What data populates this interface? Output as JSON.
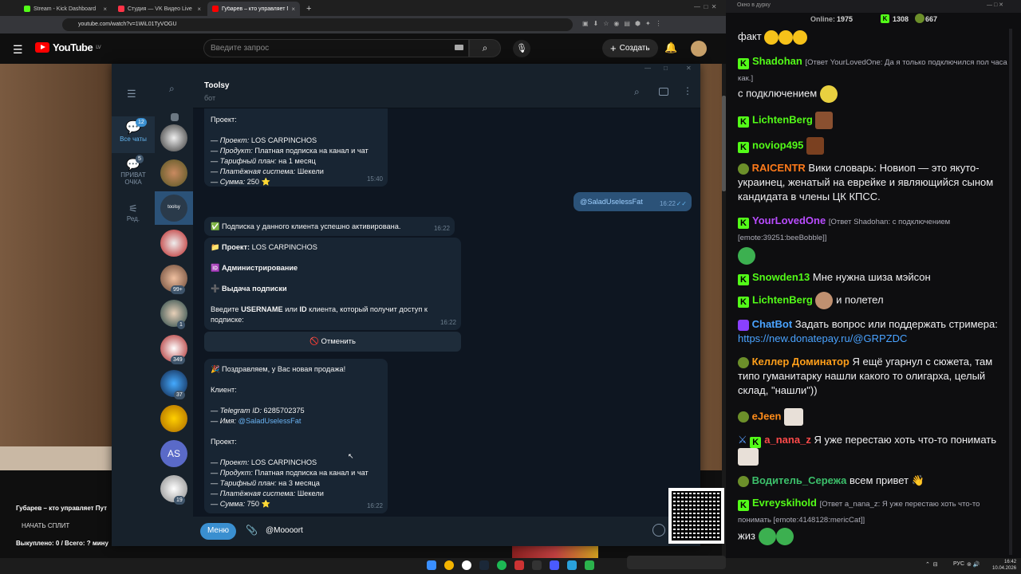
{
  "browser": {
    "tabs": [
      {
        "label": "Stream - Kick Dashboard",
        "color": "#53fc18"
      },
      {
        "label": "Студия — VK Видео Live",
        "color": "#ff3347"
      },
      {
        "label": "Губарев – кто управляет Путин",
        "color": "#ff0000"
      }
    ],
    "new_tab": "+",
    "url": "youtube.com/watch?v=1WiL01TyVOGU"
  },
  "youtube": {
    "logo": "YouTube",
    "region": "LV",
    "search_placeholder": "Введите запрос",
    "create_label": "Создать",
    "video_title": "Губарев – кто управляет Пут",
    "split_label": "НАЧАТЬ СПЛИТ",
    "bought_label": "Выкуплено: 0 / Всего: ? мину"
  },
  "telegram": {
    "chat_name": "Toolsy",
    "chat_status": "бот",
    "rail": {
      "all_chats_label": "Все чаты",
      "all_chats_badge": "12",
      "private_label_1": "ПРИВАТ",
      "private_label_2": "ОЧКА",
      "private_badge": "5",
      "edit_label": "Ред."
    },
    "list_badges": [
      "99+",
      "1",
      "349",
      "37",
      "19"
    ],
    "list_initials": "AS",
    "messages": {
      "m1_project_header": "Проект:",
      "m1_lines": [
        {
          "k": "— Проект:",
          "v": " LOS CARPINCHOS"
        },
        {
          "k": "— Продукт:",
          "v": " Платная подписка на канал и чат"
        },
        {
          "k": "— Тарифный план:",
          "v": " на 1 месяц"
        },
        {
          "k": "— Платёжная система:",
          "v": " Шекели"
        },
        {
          "k": "— Сумма:",
          "v": " 250 ⭐"
        }
      ],
      "m1_time": "15:40",
      "out_text": "@SaladUselessFat",
      "out_time": "16:22",
      "m2_text": "✅ Подписка у данного клиента успешно активирована.",
      "m2_time": "16:22",
      "m3_project": "📁 Проект:",
      "m3_project_val": " LOS CARPINCHOS",
      "m3_admin": "🆔 Администрирование",
      "m3_issue": "➕ Выдача подписки",
      "m3_prompt_a": "Введите ",
      "m3_prompt_b": "USERNAME",
      "m3_prompt_c": " или ",
      "m3_prompt_d": "ID",
      "m3_prompt_e": " клиента, который получит доступ к подписке:",
      "m3_time": "16:22",
      "cancel_button": "🚫 Отменить",
      "m4_congrats": "🎉 Поздравляем, у Вас новая продажа!",
      "m4_client": "Клиент:",
      "m4_tg_k": "— Telegram ID:",
      "m4_tg_v": " 6285702375",
      "m4_name_k": "— Имя:",
      "m4_name_v": " @SaladUselessFat",
      "m4_project_header": "Проект:",
      "m4_lines": [
        {
          "k": "— Проект:",
          "v": " LOS CARPINCHOS"
        },
        {
          "k": "— Продукт:",
          "v": " Платная подписка на канал и чат"
        },
        {
          "k": "— Тарифный план:",
          "v": " на 3 месяца"
        },
        {
          "k": "— Платёжная система:",
          "v": " Шекели"
        },
        {
          "k": "— Сумма:",
          "v": " 750 ⭐"
        }
      ],
      "m4_time": "16:22"
    },
    "menu_button": "Меню",
    "input_value": "@Moooort"
  },
  "chat": {
    "window_title": "Окно в дурку",
    "online_label": "Online:",
    "online_count": "1975",
    "kick_count": "1308",
    "vk_count": "667",
    "messages": [
      {
        "user": "",
        "text": "факт",
        "color": "#efeff1"
      },
      {
        "user": "Shadohan",
        "reply": "[Ответ YourLovedOne: Да я только подключился пол часа как.]",
        "text": "с подключением",
        "color": "#53fc18"
      },
      {
        "user": "LichtenBerg",
        "text": "",
        "color": "#53fc18"
      },
      {
        "user": "noviop495",
        "text": "",
        "color": "#53fc18"
      },
      {
        "user": "RAICENTR",
        "text": "Вики словарь: Новиоп — это якуто-украинец, женатый на еврейке и являющийся сыном кандидата в члены ЦК КПСС.",
        "color": "#ff7a1a"
      },
      {
        "user": "YourLovedOne",
        "reply": "[Ответ Shadohan: с подключением [emote:39251:beeBobble]]",
        "text": "",
        "color": "#b94cff"
      },
      {
        "user": "Snowden13",
        "text": "Мне нужна шиза мэйсон",
        "color": "#53fc18"
      },
      {
        "user": "LichtenBerg",
        "text": "и полетел",
        "color": "#53fc18"
      },
      {
        "user": "ChatBot",
        "text": "Задать вопрос или поддержать стримера: ",
        "link": "https://new.donatepay.ru/@GRPZDC",
        "color": "#4aa3ff"
      },
      {
        "user": "Келлер Доминатор",
        "text": "Я ещё угарнул с сюжета, там типо гуманитарку нашли какого то олигарха, целый склад, \"нашли\"))",
        "color": "#ff9f1a"
      },
      {
        "user": "eJeen",
        "text": "",
        "color": "#ff8c1a"
      },
      {
        "user": "a_nana_z",
        "text": "Я уже перестаю хоть что-то понимать",
        "color": "#ff4a4a"
      },
      {
        "user": "Водитель_Сережа",
        "text": "всем привет 👋",
        "color": "#3cc06b"
      },
      {
        "user": "Evreyskihold",
        "reply": "[Ответ a_nana_z: Я уже перестаю хоть что-то понимать [emote:4148128:mericCat]]",
        "text": "жиз",
        "color": "#53fc18"
      }
    ]
  },
  "taskbar": {
    "lang": "РУС",
    "time": "16:42",
    "date": "10.04.2026"
  },
  "colors": {
    "kick": "#53fc18",
    "tg_bg": "#0e1621",
    "tg_bubble": "#182533",
    "tg_out": "#2b5278",
    "tg_accent": "#64b5ef"
  }
}
